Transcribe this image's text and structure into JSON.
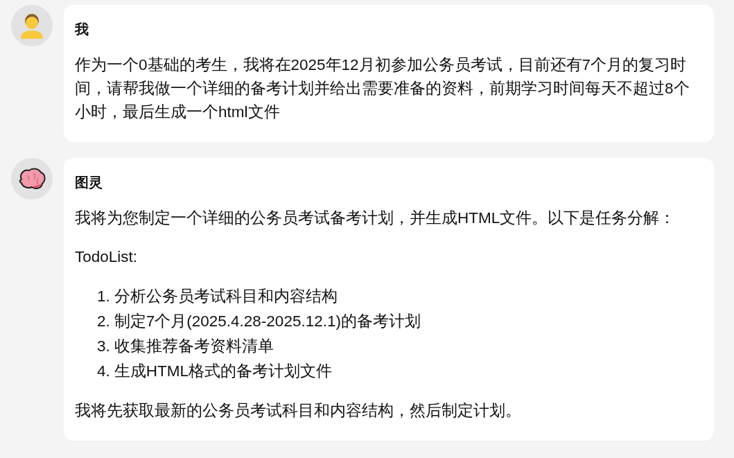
{
  "messages": [
    {
      "kind": "user",
      "sender": "我",
      "blocks": [
        {
          "kind": "paragraph",
          "text": "作为一个0基础的考生，我将在2025年12月初参加公务员考试，目前还有7个月的复习时间，请帮我做一个详细的备考计划并给出需要准备的资料，前期学习时间每天不超过8个小时，最后生成一个html文件"
        }
      ]
    },
    {
      "kind": "assistant",
      "sender": "图灵",
      "blocks": [
        {
          "kind": "paragraph",
          "text": "我将为您制定一个详细的公务员考试备考计划，并生成HTML文件。以下是任务分解："
        },
        {
          "kind": "paragraph",
          "text": "TodoList:"
        },
        {
          "kind": "list",
          "items": [
            {
              "number": "1.",
              "text": "分析公务员考试科目和内容结构"
            },
            {
              "number": "2.",
              "text": "制定7个月(2025.4.28-2025.12.1)的备考计划"
            },
            {
              "number": "3.",
              "text": "收集推荐备考资料清单"
            },
            {
              "number": "4.",
              "text": "生成HTML格式的备考计划文件"
            }
          ]
        },
        {
          "kind": "paragraph",
          "text": "我将先获取最新的公务员考试科目和内容结构，然后制定计划。"
        }
      ]
    }
  ]
}
